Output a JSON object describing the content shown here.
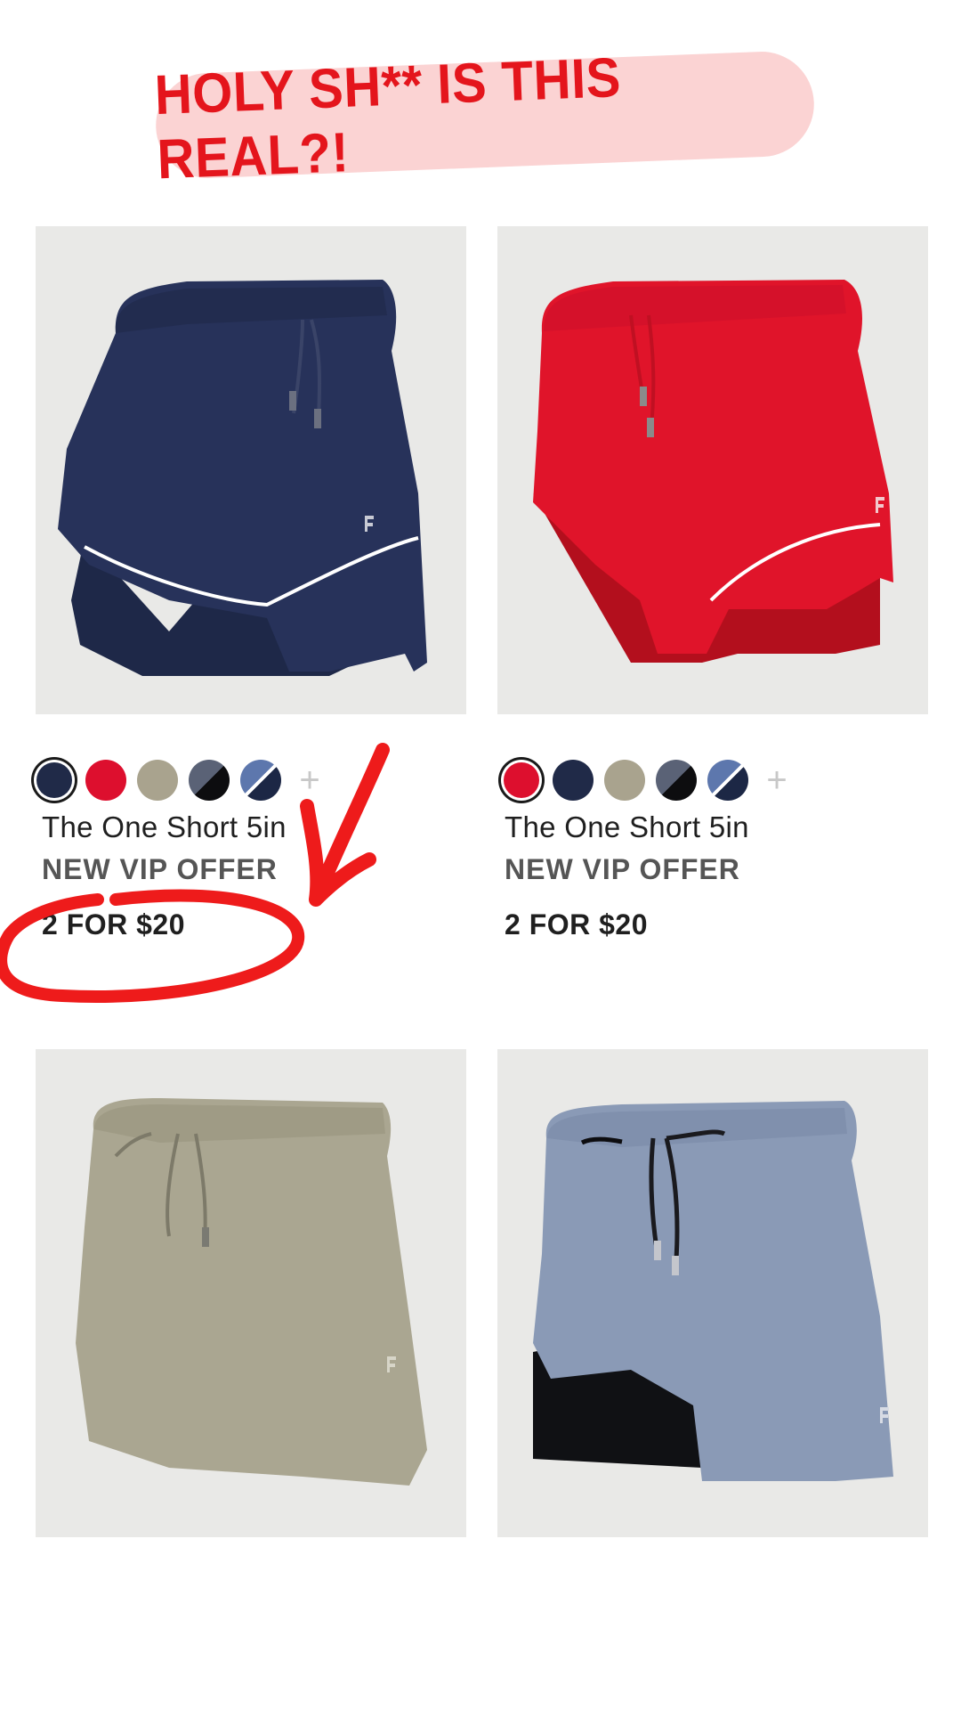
{
  "banner": {
    "text": "HOLY SH** IS THIS REAL?!"
  },
  "colors": {
    "accent_red": "#e4151c",
    "banner_bg": "#fbd3d3",
    "annotation_red": "#ee1b1b"
  },
  "products": [
    {
      "title": "The One Short 5in",
      "offer": "NEW VIP OFFER",
      "price": "2 FOR $20",
      "image": "navy-shorts-image",
      "swatches": [
        "navy",
        "red",
        "khaki",
        "slate-black",
        "blue-navy"
      ],
      "selected_swatch": "navy"
    },
    {
      "title": "The One Short 5in",
      "offer": "NEW VIP OFFER",
      "price": "2 FOR $20",
      "image": "red-shorts-image",
      "swatches": [
        "red",
        "navy",
        "khaki",
        "slate-black",
        "blue-navy"
      ],
      "selected_swatch": "red"
    },
    {
      "image": "khaki-shorts-image"
    },
    {
      "image": "blue-gray-shorts-image"
    }
  ],
  "more_colors_icon": "plus-icon",
  "annotations": [
    "red-arrow",
    "red-circle"
  ]
}
